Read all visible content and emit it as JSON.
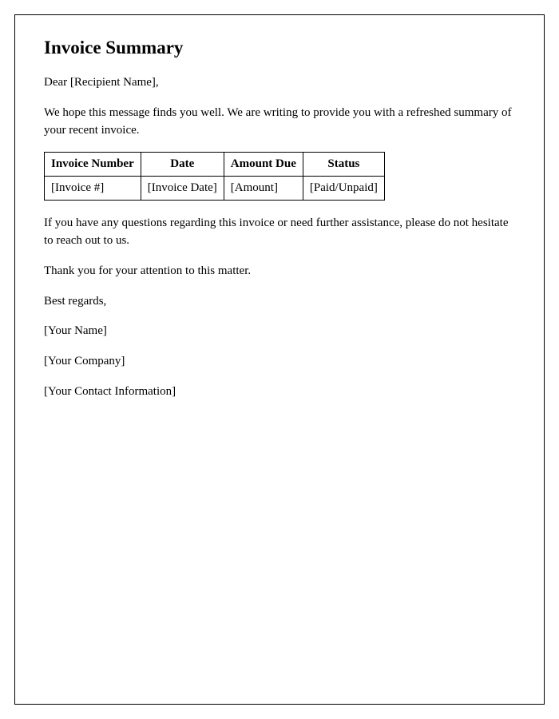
{
  "title": "Invoice Summary",
  "greeting": "Dear [Recipient Name],",
  "intro": "We hope this message finds you well. We are writing to provide you with a refreshed summary of your recent invoice.",
  "table": {
    "headers": {
      "invoice_number": "Invoice Number",
      "date": "Date",
      "amount_due": "Amount Due",
      "status": "Status"
    },
    "row": {
      "invoice_number": "[Invoice #]",
      "date": "[Invoice Date]",
      "amount_due": "[Amount]",
      "status": "[Paid/Unpaid]"
    }
  },
  "assistance": "If you have any questions regarding this invoice or need further assistance, please do not hesitate to reach out to us.",
  "thanks": "Thank you for your attention to this matter.",
  "closing": "Best regards,",
  "sender_name": "[Your Name]",
  "sender_company": "[Your Company]",
  "sender_contact": "[Your Contact Information]"
}
